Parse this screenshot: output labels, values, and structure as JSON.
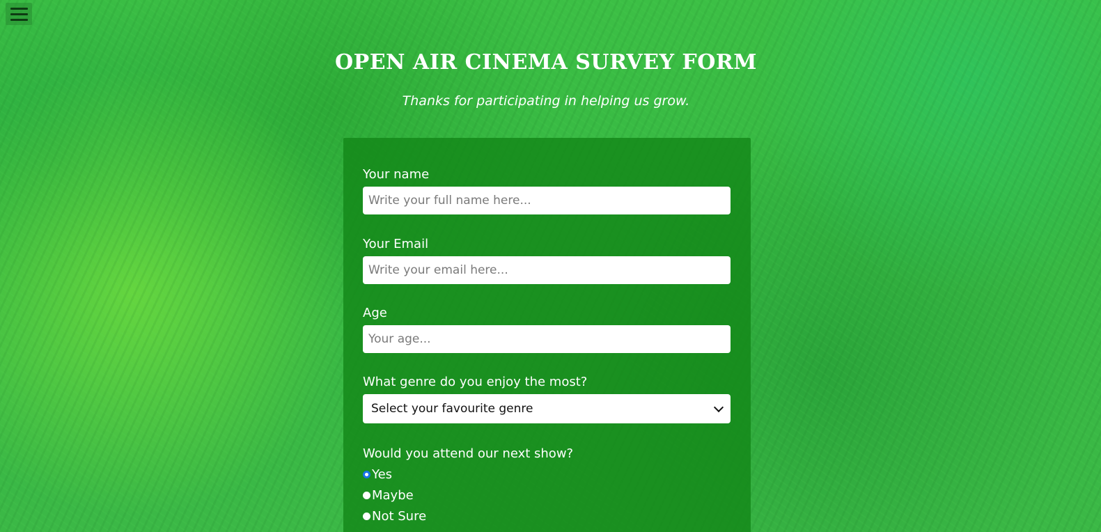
{
  "page": {
    "title": "OPEN AIR CINEMA SURVEY FORM",
    "subtitle": "Thanks for participating in helping us grow."
  },
  "menu": {
    "icon": "hamburger-menu-icon"
  },
  "form": {
    "name": {
      "label": "Your name",
      "value": "",
      "placeholder": "Write your full name here..."
    },
    "email": {
      "label": "Your Email",
      "value": "",
      "placeholder": "Write your email here..."
    },
    "age": {
      "label": "Age",
      "value": "",
      "placeholder": "Your age..."
    },
    "genre": {
      "label": "What genre do you enjoy the most?",
      "selected": "Select your favourite genre"
    },
    "attend": {
      "label": "Would you attend our next show?",
      "options": [
        {
          "label": "Yes",
          "checked": true
        },
        {
          "label": "Maybe",
          "checked": false
        },
        {
          "label": "Not Sure",
          "checked": false
        }
      ]
    }
  },
  "colors": {
    "background": "#3bb846",
    "panel": "#17861b",
    "radio_accent": "#1a73e8"
  }
}
